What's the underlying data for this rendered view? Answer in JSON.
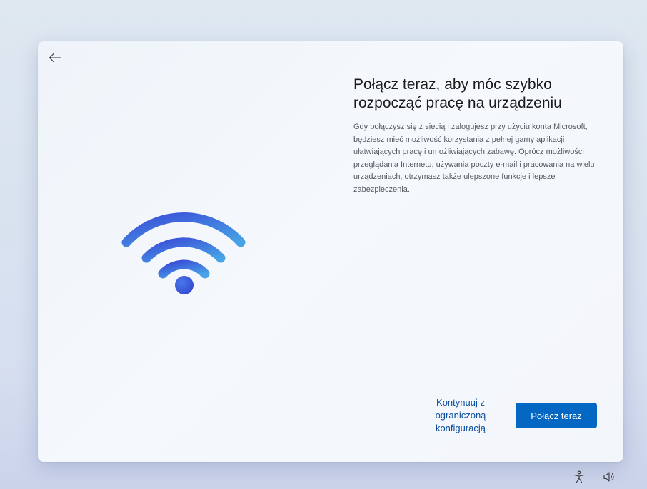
{
  "setup": {
    "title": "Połącz teraz, aby móc szybko rozpocząć pracę na urządzeniu",
    "description": "Gdy połączysz się z siecią i zalogujesz przy użyciu konta Microsoft, będziesz mieć możliwość korzystania z pełnej gamy aplikacji ułatwiających pracę i umożliwiających zabawę. Oprócz możliwości przeglądania Internetu, używania poczty e-mail i pracowania na wielu urządzeniach, otrzymasz także ulepszone funkcje i lepsze zabezpieczenia.",
    "limited_setup_label": "Kontynuuj z ograniczoną konfiguracją",
    "connect_label": "Połącz teraz",
    "illustration_icon": "wifi-icon",
    "back_icon": "arrow-left-icon"
  },
  "taskbar": {
    "icons": [
      "accessibility-icon",
      "volume-icon"
    ]
  },
  "colors": {
    "accent": "#0467c4",
    "link": "#0a4fa0",
    "wifi_gradient_start": "#3b4fd8",
    "wifi_gradient_end": "#47a4e6"
  }
}
